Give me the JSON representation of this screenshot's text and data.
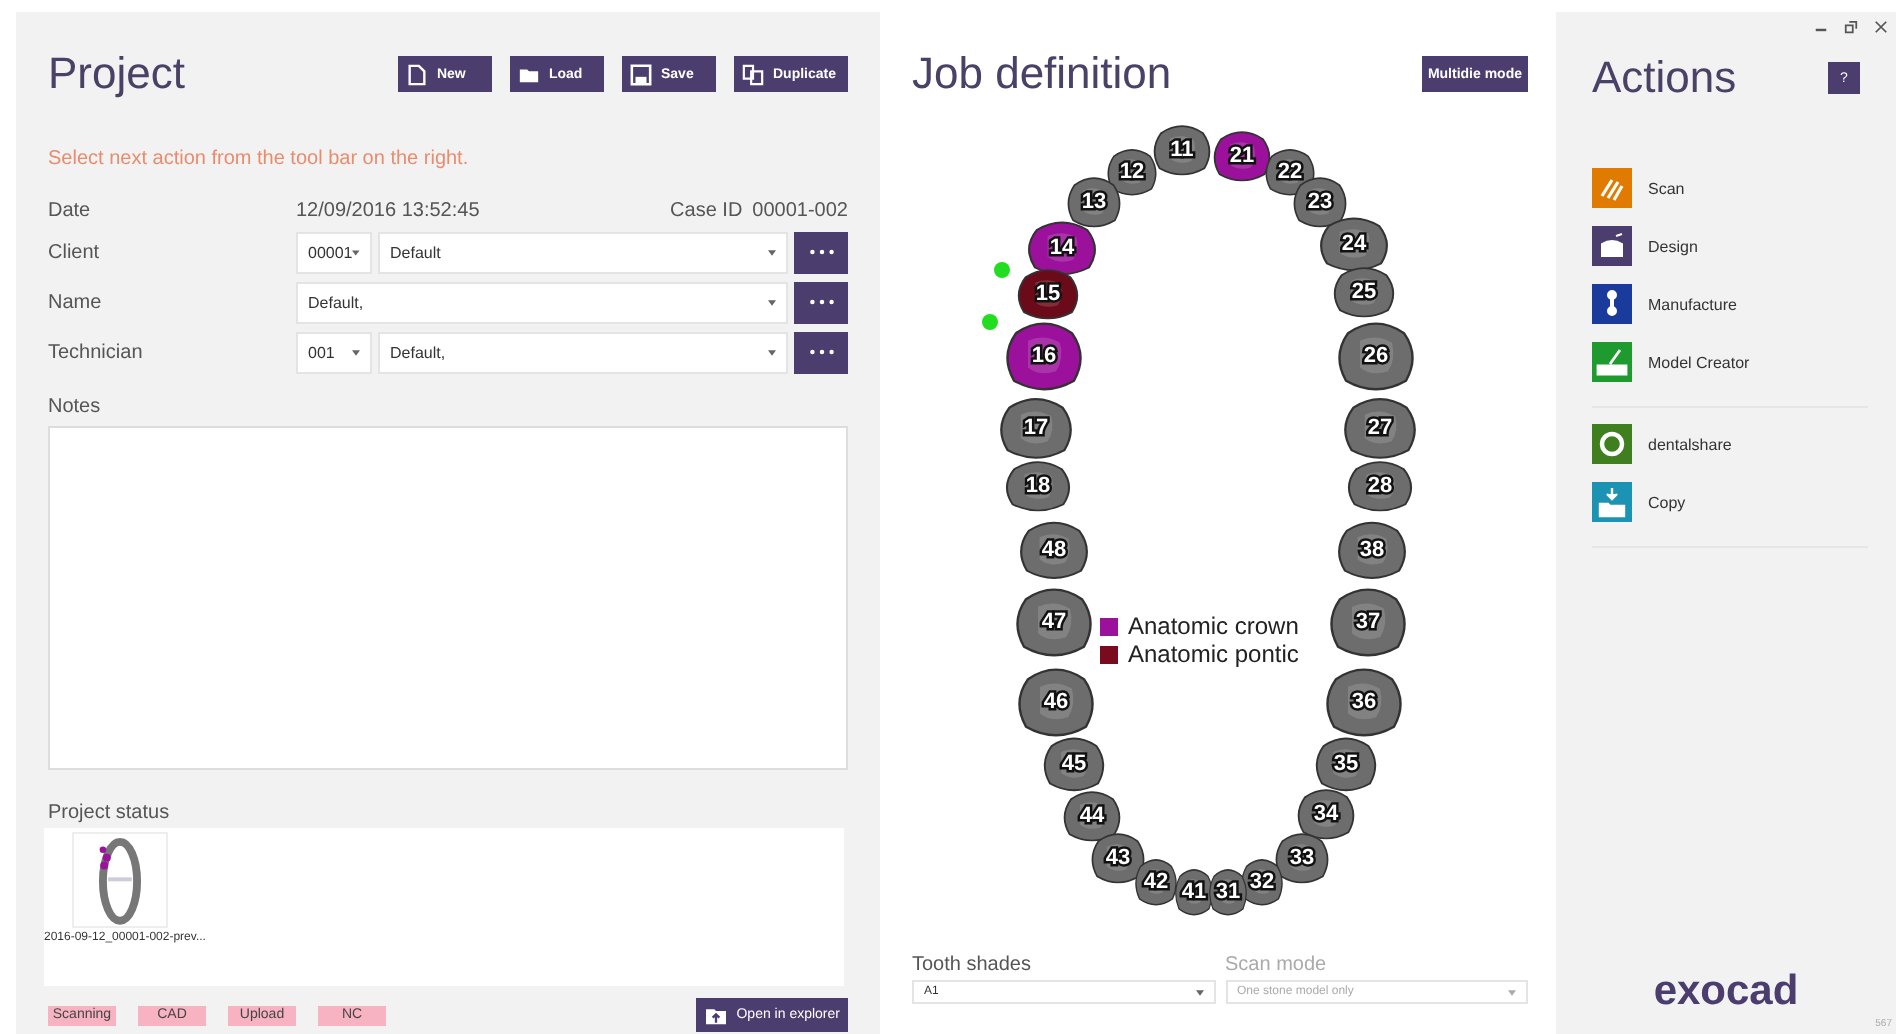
{
  "project": {
    "title": "Project",
    "toolbar": [
      {
        "label": "New",
        "kind": "new"
      },
      {
        "label": "Load",
        "kind": "load"
      },
      {
        "label": "Save",
        "kind": "save"
      },
      {
        "label": "Duplicate",
        "kind": "duplicate"
      }
    ],
    "hint": "Select next action from the tool bar on the right.",
    "date_label": "Date",
    "date": "12/09/2016  13:52:45",
    "case_label": "Case ID",
    "case_id": "00001-002",
    "fields": [
      {
        "label": "Client",
        "code": "00001",
        "value": "Default"
      },
      {
        "label": "Name",
        "value": "Default,"
      },
      {
        "label": "Technician",
        "code": "001",
        "value": "Default,"
      }
    ],
    "notes_label": "Notes",
    "status_label": "Project status",
    "file": "2016-09-12_00001-002-prev...",
    "stages": [
      {
        "label": "Scanning",
        "done": false
      },
      {
        "label": "CAD",
        "done": false
      },
      {
        "label": "Upload",
        "done": false
      },
      {
        "label": "NC",
        "done": false
      }
    ],
    "open_button": "Open in explorer"
  },
  "job": {
    "title": "Job definition",
    "mode_button": "Multidie mode",
    "teeth": [
      {
        "number": "11",
        "kind": "none",
        "connector": false
      },
      {
        "number": "21",
        "kind": "crown",
        "connector": false
      },
      {
        "number": "12",
        "kind": "none",
        "connector": false
      },
      {
        "number": "22",
        "kind": "none",
        "connector": false
      },
      {
        "number": "13",
        "kind": "none",
        "connector": false
      },
      {
        "number": "23",
        "kind": "none",
        "connector": false
      },
      {
        "number": "14",
        "kind": "crown",
        "connector": false
      },
      {
        "number": "24",
        "kind": "none",
        "connector": false
      },
      {
        "number": "15",
        "kind": "pontic",
        "connector": true
      },
      {
        "number": "25",
        "kind": "none",
        "connector": false
      },
      {
        "number": "16",
        "kind": "crown",
        "connector": true
      },
      {
        "number": "26",
        "kind": "none",
        "connector": false
      },
      {
        "number": "17",
        "kind": "none",
        "connector": false
      },
      {
        "number": "27",
        "kind": "none",
        "connector": false
      },
      {
        "number": "18",
        "kind": "none",
        "connector": false
      },
      {
        "number": "28",
        "kind": "none",
        "connector": false
      },
      {
        "number": "48",
        "kind": "none",
        "connector": false
      },
      {
        "number": "38",
        "kind": "none",
        "connector": false
      },
      {
        "number": "47",
        "kind": "none",
        "connector": false
      },
      {
        "number": "37",
        "kind": "none",
        "connector": false
      },
      {
        "number": "46",
        "kind": "none",
        "connector": false
      },
      {
        "number": "36",
        "kind": "none",
        "connector": false
      },
      {
        "number": "45",
        "kind": "none",
        "connector": false
      },
      {
        "number": "35",
        "kind": "none",
        "connector": false
      },
      {
        "number": "44",
        "kind": "none",
        "connector": false
      },
      {
        "number": "34",
        "kind": "none",
        "connector": false
      },
      {
        "number": "43",
        "kind": "none",
        "connector": false
      },
      {
        "number": "33",
        "kind": "none",
        "connector": false
      },
      {
        "number": "42",
        "kind": "none",
        "connector": false
      },
      {
        "number": "32",
        "kind": "none",
        "connector": false
      },
      {
        "number": "41",
        "kind": "none",
        "connector": false
      },
      {
        "number": "31",
        "kind": "none",
        "connector": false
      }
    ],
    "legend": [
      {
        "label": "Anatomic crown",
        "color": "#9b119b"
      },
      {
        "label": "Anatomic pontic",
        "color": "#7a0a1e"
      }
    ],
    "shades_label": "Tooth shades",
    "shade": "A1",
    "scan_label": "Scan mode",
    "scan_mode": "One stone model only",
    "scan_disabled": true
  },
  "actions": {
    "title": "Actions",
    "help": "?",
    "items": [
      {
        "label": "Scan",
        "kind": "scan",
        "color": "#e07b00"
      },
      {
        "label": "Design",
        "kind": "design",
        "color": "#4b3d6e"
      },
      {
        "label": "Manufacture",
        "kind": "manufacture",
        "color": "#1a3a9c"
      },
      {
        "label": "Model Creator",
        "kind": "model",
        "color": "#1f9a2e"
      }
    ],
    "extras": [
      {
        "label": "dentalshare",
        "kind": "share",
        "color": "#3f7f1f"
      },
      {
        "label": "Copy",
        "kind": "copy",
        "color": "#1d93b3"
      }
    ],
    "logo": "exocad",
    "version": "567"
  }
}
